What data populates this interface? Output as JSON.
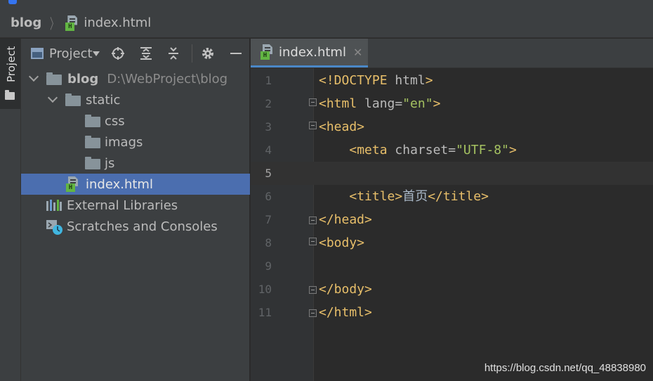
{
  "breadcrumb": {
    "root": "blog",
    "file": "index.html"
  },
  "stripe": {
    "project_tab": "Project"
  },
  "project_panel": {
    "title": "Project",
    "tree": [
      {
        "label": "blog",
        "path": "D:\\WebProject\\blog",
        "type": "folder",
        "expanded": true,
        "level": 0
      },
      {
        "label": "static",
        "type": "folder",
        "expanded": true,
        "level": 1
      },
      {
        "label": "css",
        "type": "folder",
        "level": 2
      },
      {
        "label": "imags",
        "type": "folder",
        "level": 2
      },
      {
        "label": "js",
        "type": "folder",
        "level": 2
      },
      {
        "label": "index.html",
        "type": "html",
        "level": 1,
        "selected": true
      },
      {
        "label": "External Libraries",
        "type": "library",
        "level": 0
      },
      {
        "label": "Scratches and Consoles",
        "type": "scratch",
        "level": 0
      }
    ]
  },
  "editor": {
    "tab_label": "index.html",
    "current_line": 5,
    "lines": [
      {
        "num": "1",
        "code": "<!DOCTYPE html>"
      },
      {
        "num": "2",
        "code": "<html lang=\"en\">"
      },
      {
        "num": "3",
        "code": "<head>"
      },
      {
        "num": "4",
        "code": "    <meta charset=\"UTF-8\">"
      },
      {
        "num": "5",
        "code": ""
      },
      {
        "num": "6",
        "code": "    <title>首页</title>"
      },
      {
        "num": "7",
        "code": "</head>"
      },
      {
        "num": "8",
        "code": "<body>"
      },
      {
        "num": "9",
        "code": ""
      },
      {
        "num": "10",
        "code": "</body>"
      },
      {
        "num": "11",
        "code": "</html>"
      }
    ]
  },
  "watermark": "https://blog.csdn.net/qq_48838980",
  "colors": {
    "tag": "#e8bf6a",
    "string": "#a5c261",
    "selection": "#4b6eaf",
    "tab_underline": "#4a88c7"
  }
}
